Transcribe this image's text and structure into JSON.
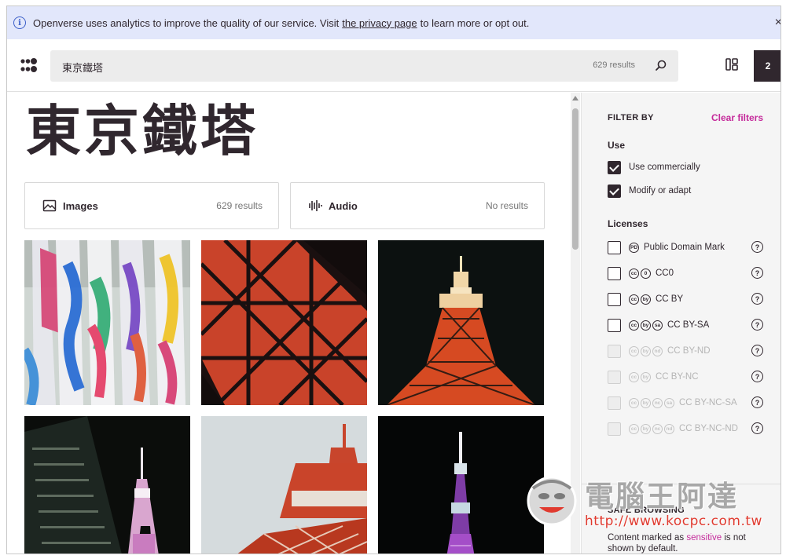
{
  "banner": {
    "text_before": "Openverse uses analytics to improve the quality of our service. Visit",
    "link": "the privacy page",
    "text_after": "to learn more or opt out.",
    "close": "×"
  },
  "header": {
    "search_value": "東京鐵塔",
    "result_count": "629 results",
    "filter_badge": "2"
  },
  "main": {
    "title": "東京鐵塔",
    "cards": [
      {
        "label": "Images",
        "results": "629 results"
      },
      {
        "label": "Audio",
        "results": "No results"
      }
    ],
    "photos": [
      {
        "alt": "koinobori-streamers"
      },
      {
        "alt": "tokyo-tower-lattice"
      },
      {
        "alt": "tokyo-tower-top-night"
      },
      {
        "alt": "skytree-with-building"
      },
      {
        "alt": "tokyo-tower-observatory"
      },
      {
        "alt": "skytree-purple"
      }
    ]
  },
  "sidebar": {
    "filter_by": "FILTER BY",
    "clear_filters": "Clear filters",
    "use_heading": "Use",
    "use_items": [
      {
        "label": "Use commercially",
        "checked": true
      },
      {
        "label": "Modify or adapt",
        "checked": true
      }
    ],
    "licenses_heading": "Licenses",
    "licenses": [
      {
        "label": "Public Domain Mark",
        "icons": [
          "PD"
        ],
        "disabled": false
      },
      {
        "label": "CC0",
        "icons": [
          "cc",
          "0"
        ],
        "disabled": false
      },
      {
        "label": "CC BY",
        "icons": [
          "cc",
          "by"
        ],
        "disabled": false
      },
      {
        "label": "CC BY-SA",
        "icons": [
          "cc",
          "by",
          "sa"
        ],
        "disabled": false
      },
      {
        "label": "CC BY-ND",
        "icons": [
          "cc",
          "by",
          "nd"
        ],
        "disabled": true
      },
      {
        "label": "CC BY-NC",
        "icons": [
          "cc",
          "by"
        ],
        "disabled": true
      },
      {
        "label": "CC BY-NC-SA",
        "icons": [
          "cc",
          "by",
          "nc",
          "sa"
        ],
        "disabled": true
      },
      {
        "label": "CC BY-NC-ND",
        "icons": [
          "cc",
          "by",
          "nc",
          "nd"
        ],
        "disabled": true
      }
    ],
    "help_glyph": "?",
    "safe_heading": "SAFE BROWSING",
    "safe_text_before": "Content marked as",
    "safe_link": "sensitive",
    "safe_text_after": "is not shown by default."
  },
  "watermark": {
    "name": "電腦王阿達",
    "url": "http://www.kocpc.com.tw"
  },
  "colors": {
    "brand_dark": "#30272e",
    "accent_pink": "#c52b9b",
    "banner_bg": "#e2e7fb"
  }
}
